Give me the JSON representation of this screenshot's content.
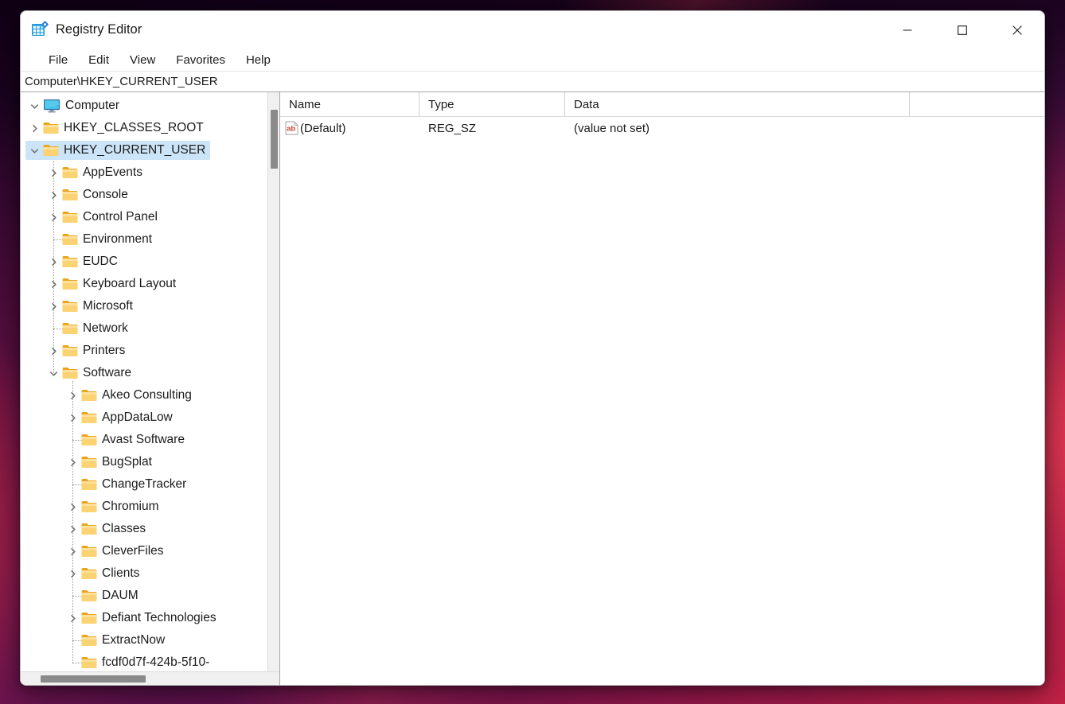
{
  "window": {
    "title": "Registry Editor",
    "app_icon": "registry-grid-icon",
    "controls": {
      "minimize": "minimize-icon",
      "maximize": "maximize-icon",
      "close": "close-icon"
    }
  },
  "menubar": {
    "items": [
      {
        "label": "File"
      },
      {
        "label": "Edit"
      },
      {
        "label": "View"
      },
      {
        "label": "Favorites"
      },
      {
        "label": "Help"
      }
    ]
  },
  "address": {
    "path": "Computer\\HKEY_CURRENT_USER"
  },
  "tree": {
    "nodes": [
      {
        "label": "Computer",
        "depth": 0,
        "icon": "monitor-icon",
        "expander": "expanded"
      },
      {
        "label": "HKEY_CLASSES_ROOT",
        "depth": 1,
        "icon": "folder-icon",
        "expander": "collapsed"
      },
      {
        "label": "HKEY_CURRENT_USER",
        "depth": 1,
        "icon": "folder-icon",
        "expander": "expanded",
        "selected": true
      },
      {
        "label": "AppEvents",
        "depth": 2,
        "icon": "folder-icon",
        "expander": "collapsed"
      },
      {
        "label": "Console",
        "depth": 2,
        "icon": "folder-icon",
        "expander": "collapsed"
      },
      {
        "label": "Control Panel",
        "depth": 2,
        "icon": "folder-icon",
        "expander": "collapsed"
      },
      {
        "label": "Environment",
        "depth": 2,
        "icon": "folder-icon",
        "expander": "none"
      },
      {
        "label": "EUDC",
        "depth": 2,
        "icon": "folder-icon",
        "expander": "collapsed"
      },
      {
        "label": "Keyboard Layout",
        "depth": 2,
        "icon": "folder-icon",
        "expander": "collapsed"
      },
      {
        "label": "Microsoft",
        "depth": 2,
        "icon": "folder-icon",
        "expander": "collapsed"
      },
      {
        "label": "Network",
        "depth": 2,
        "icon": "folder-icon",
        "expander": "none"
      },
      {
        "label": "Printers",
        "depth": 2,
        "icon": "folder-icon",
        "expander": "collapsed"
      },
      {
        "label": "Software",
        "depth": 2,
        "icon": "folder-icon",
        "expander": "expanded"
      },
      {
        "label": "Akeo Consulting",
        "depth": 3,
        "icon": "folder-icon",
        "expander": "collapsed"
      },
      {
        "label": "AppDataLow",
        "depth": 3,
        "icon": "folder-icon",
        "expander": "collapsed"
      },
      {
        "label": "Avast Software",
        "depth": 3,
        "icon": "folder-icon",
        "expander": "none"
      },
      {
        "label": "BugSplat",
        "depth": 3,
        "icon": "folder-icon",
        "expander": "collapsed"
      },
      {
        "label": "ChangeTracker",
        "depth": 3,
        "icon": "folder-icon",
        "expander": "none"
      },
      {
        "label": "Chromium",
        "depth": 3,
        "icon": "folder-icon",
        "expander": "collapsed"
      },
      {
        "label": "Classes",
        "depth": 3,
        "icon": "folder-icon",
        "expander": "collapsed"
      },
      {
        "label": "CleverFiles",
        "depth": 3,
        "icon": "folder-icon",
        "expander": "collapsed"
      },
      {
        "label": "Clients",
        "depth": 3,
        "icon": "folder-icon",
        "expander": "collapsed"
      },
      {
        "label": "DAUM",
        "depth": 3,
        "icon": "folder-icon",
        "expander": "none"
      },
      {
        "label": "Defiant Technologies",
        "depth": 3,
        "icon": "folder-icon",
        "expander": "collapsed"
      },
      {
        "label": "ExtractNow",
        "depth": 3,
        "icon": "folder-icon",
        "expander": "none"
      },
      {
        "label": "fcdf0d7f-424b-5f10-",
        "depth": 3,
        "icon": "folder-icon",
        "expander": "none"
      }
    ]
  },
  "list": {
    "columns": [
      {
        "key": "name",
        "label": "Name"
      },
      {
        "key": "type",
        "label": "Type"
      },
      {
        "key": "data",
        "label": "Data"
      }
    ],
    "rows": [
      {
        "icon": "string-value-icon",
        "name": "(Default)",
        "type": "REG_SZ",
        "data": "(value not set)"
      }
    ]
  },
  "colors": {
    "selection": "#cce4f7",
    "folder": "#ffd16b",
    "window_bg": "#ffffff",
    "scrollbar_thumb": "#8a8a8a",
    "desktop": "#2a0b2e"
  }
}
